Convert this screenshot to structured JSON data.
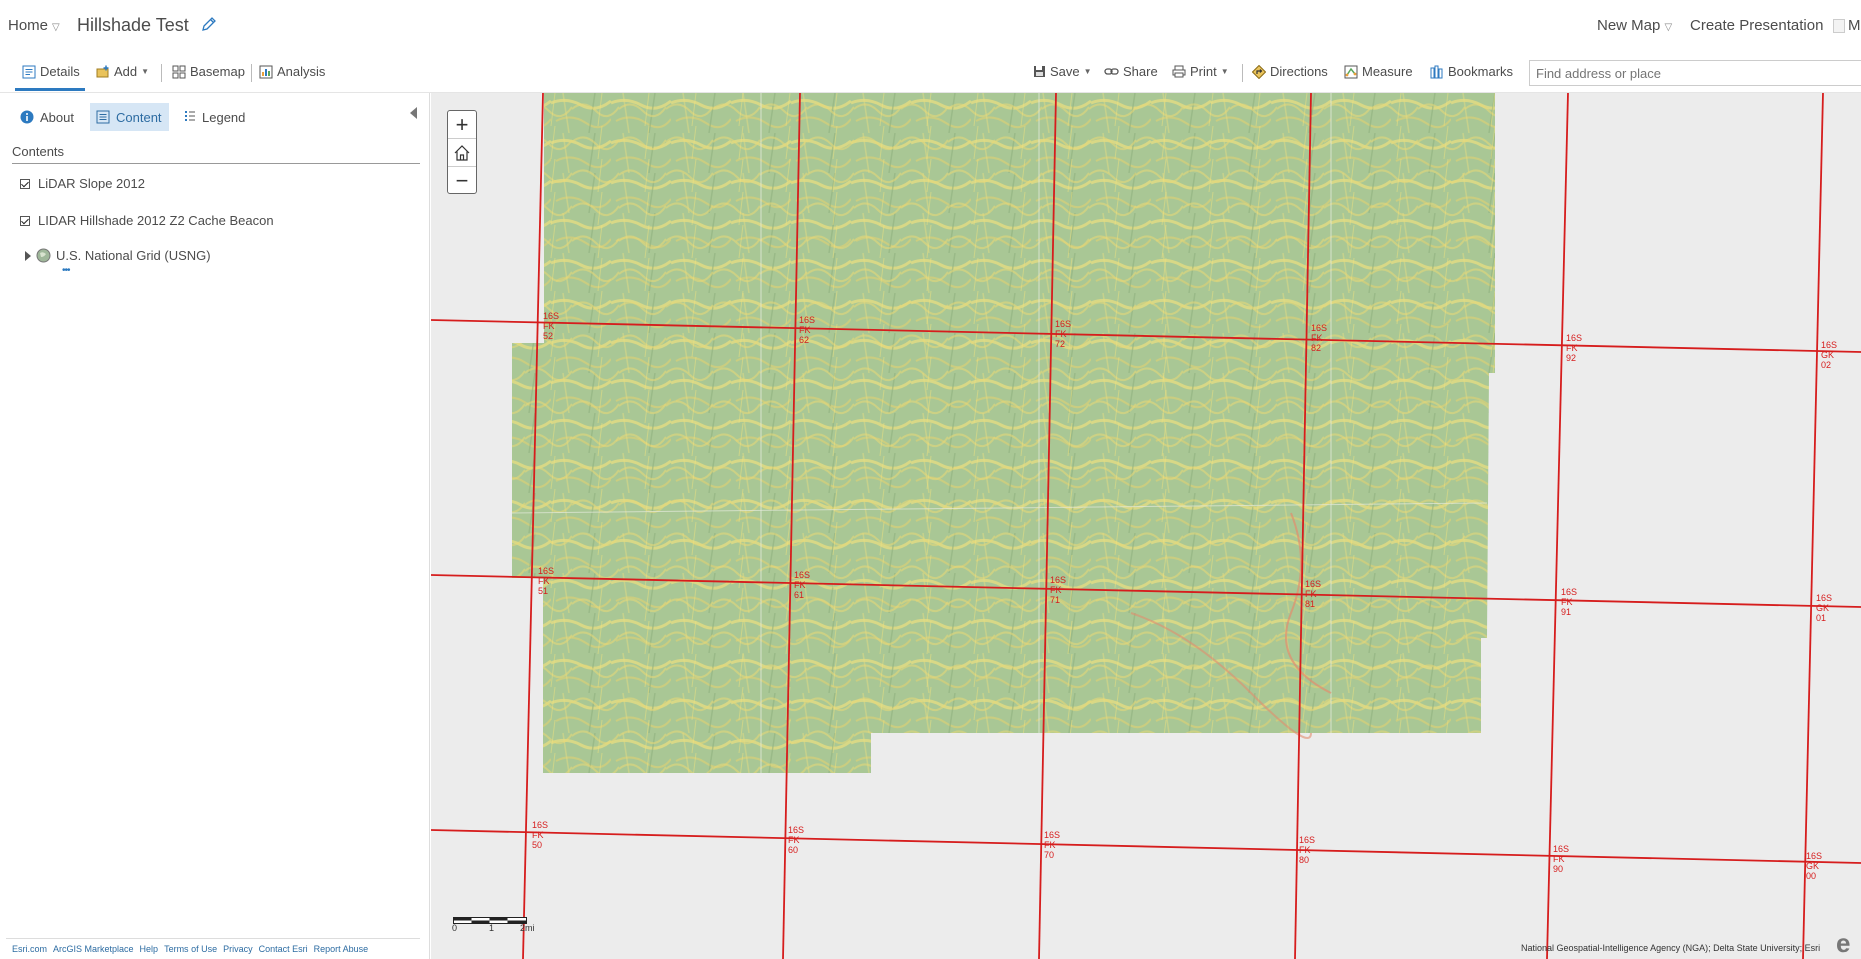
{
  "topbar": {
    "home": "Home",
    "title": "Hillshade Test",
    "new_map": "New Map",
    "create_presentation": "Create Presentation",
    "user_initial": "M"
  },
  "toolbar": {
    "details": "Details",
    "add": "Add",
    "basemap": "Basemap",
    "analysis": "Analysis",
    "save": "Save",
    "share": "Share",
    "print": "Print",
    "directions": "Directions",
    "measure": "Measure",
    "bookmarks": "Bookmarks",
    "search_placeholder": "Find address or place"
  },
  "panel": {
    "tabs": {
      "about": "About",
      "content": "Content",
      "legend": "Legend"
    },
    "contents_header": "Contents",
    "layers": [
      {
        "label": "LiDAR Slope 2012",
        "checked": true
      },
      {
        "label": "LIDAR Hillshade 2012 Z2 Cache Beacon",
        "checked": true
      },
      {
        "label": "U.S. National Grid (USNG)",
        "expandable": true
      }
    ],
    "more": "•••",
    "footer_links": [
      "Esri.com",
      "ArcGIS Marketplace",
      "Help",
      "Terms of Use",
      "Privacy",
      "Contact Esri",
      "Report Abuse"
    ]
  },
  "map": {
    "grid_labels": {
      "r1": [
        "16S FK 52",
        "16S FK 62",
        "16S FK 72",
        "16S FK 82",
        "16S FK 92",
        "16S GK 02"
      ],
      "r2": [
        "16S FK 51",
        "16S FK 61",
        "16S FK 71",
        "16S FK 81",
        "16S FK 91",
        "16S GK 01"
      ],
      "r3": [
        "16S FK 50",
        "16S FK 60",
        "16S FK 70",
        "16S FK 80",
        "16S FK 90",
        "16S GK 00"
      ]
    },
    "scale": {
      "l0": "0",
      "l1": "1",
      "l2": "2mi"
    },
    "attribution": "National Geospatial-Intelligence Agency (NGA); Delta State University; Esri",
    "esri_logo": "esri",
    "colors": {
      "grid": "#d61d1d",
      "terrain": "#a9c795",
      "slope": "#e3dc82"
    }
  }
}
